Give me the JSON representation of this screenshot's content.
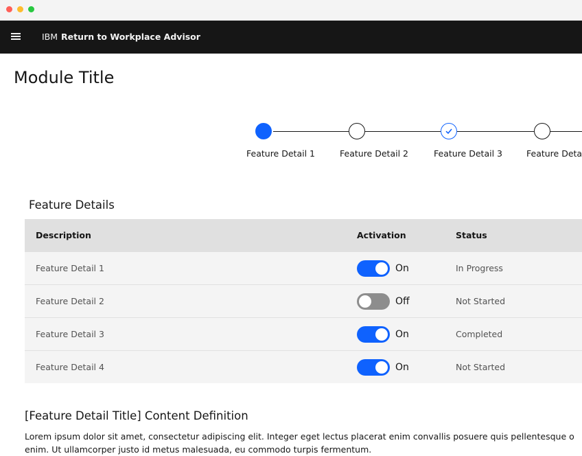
{
  "header": {
    "brand_prefix": "IBM",
    "brand_name": "Return to Workplace Advisor"
  },
  "module_title": "Module Title",
  "progress": {
    "steps": [
      {
        "label": "Feature Detail 1",
        "state": "current"
      },
      {
        "label": "Feature Detail 2",
        "state": "incomplete"
      },
      {
        "label": "Feature Detail 3",
        "state": "complete"
      },
      {
        "label": "Feature Deta",
        "state": "incomplete"
      }
    ]
  },
  "table": {
    "title": "Feature Details",
    "headers": {
      "description": "Description",
      "activation": "Activation",
      "status": "Status"
    },
    "rows": [
      {
        "description": "Feature Detail 1",
        "activation_label": "On",
        "activation_on": true,
        "status": "In Progress"
      },
      {
        "description": "Feature Detail 2",
        "activation_label": "Off",
        "activation_on": false,
        "status": "Not Started"
      },
      {
        "description": "Feature Detail 3",
        "activation_label": "On",
        "activation_on": true,
        "status": "Completed"
      },
      {
        "description": "Feature Detail 4",
        "activation_label": "On",
        "activation_on": true,
        "status": "Not Started"
      }
    ]
  },
  "content": {
    "title": "[Feature Detail Title] Content Definition",
    "body": "Lorem ipsum dolor sit amet, consectetur adipiscing elit. Integer eget lectus placerat enim convallis posuere quis pellentesque o enim. Ut ullamcorper justo id metus malesuada, eu commodo turpis fermentum."
  },
  "icons": {
    "menu": "hamburger-menu-icon",
    "check": "checkmark-icon"
  },
  "colors": {
    "accent": "#0f62fe",
    "header_bg": "#161616",
    "toggle_off": "#8d8d8d",
    "table_header_bg": "#e0e0e0",
    "table_row_bg": "#f4f4f4"
  }
}
